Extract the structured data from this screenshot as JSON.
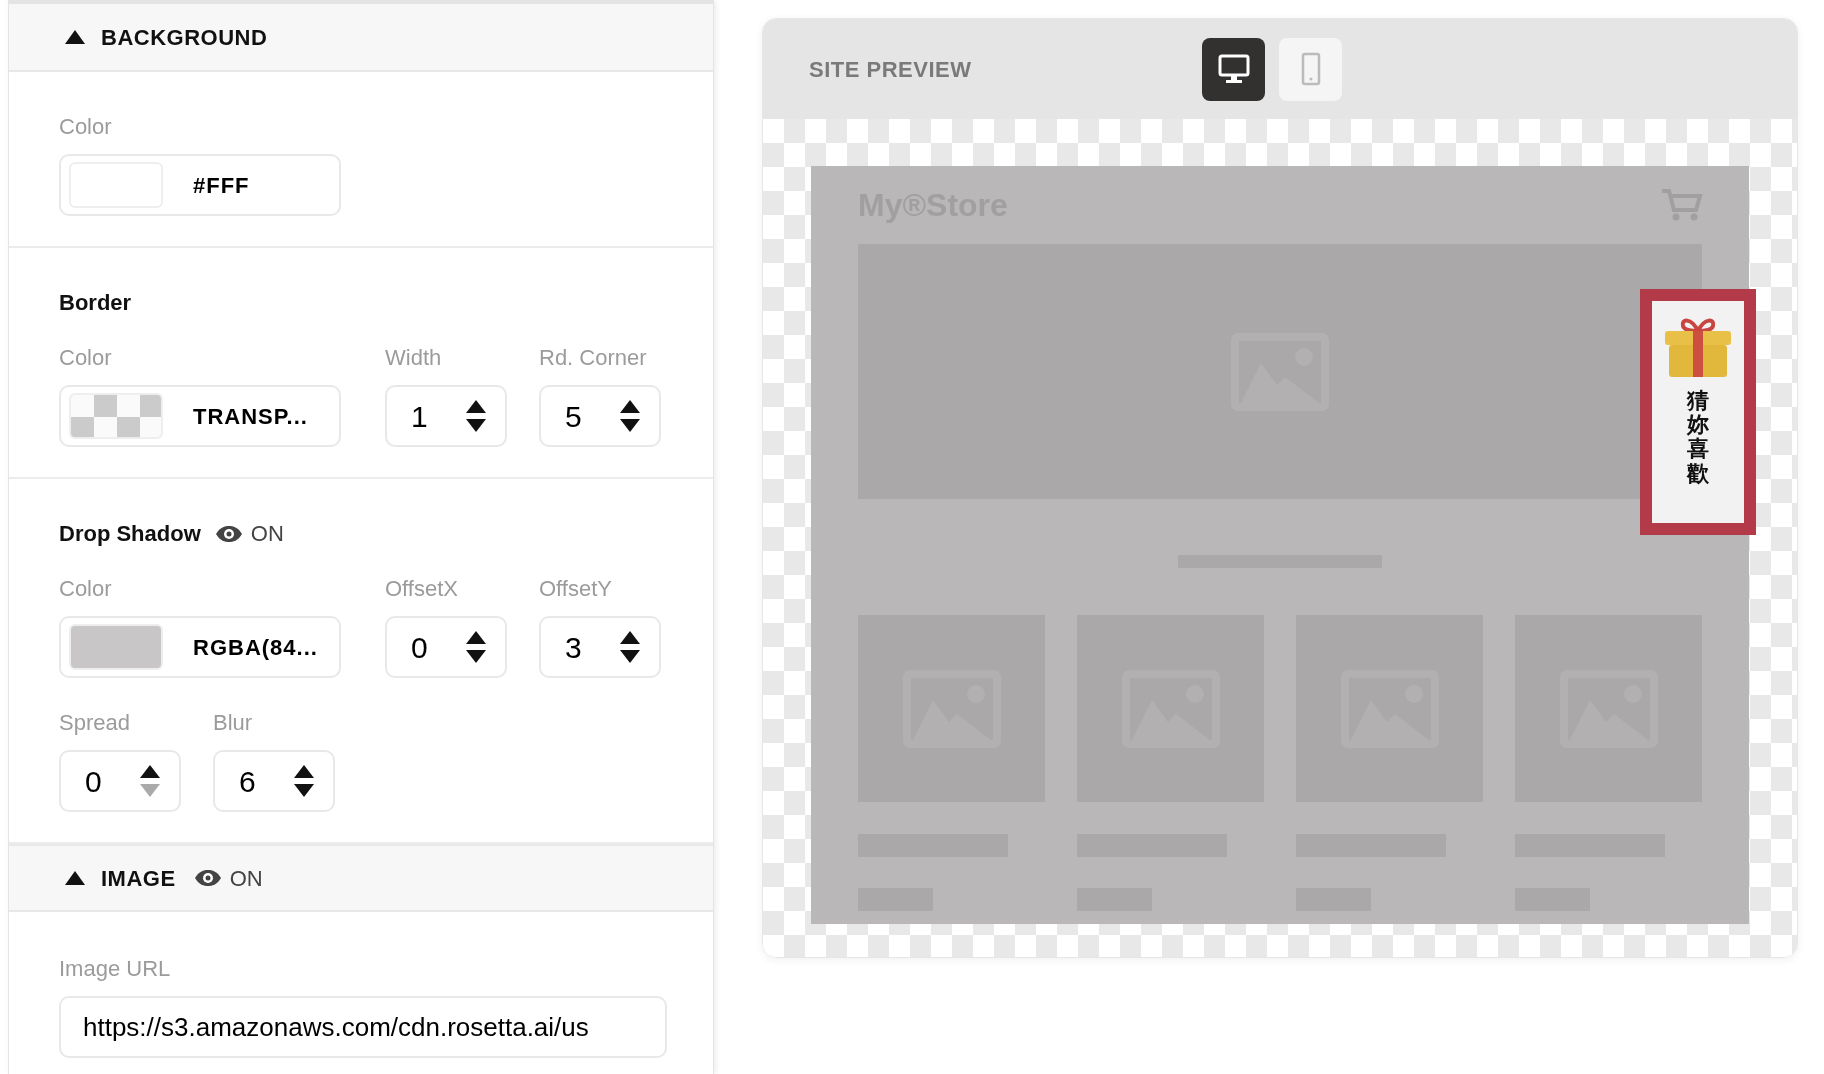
{
  "sections": [
    {
      "kind": "header",
      "title": "BACKGROUND",
      "expanded": true
    },
    {
      "kind": "group",
      "fields": [
        {
          "kind": "color",
          "label": "Color",
          "value": "#FFF",
          "swatch": {
            "kind": "solid",
            "color": "#ffffff"
          }
        }
      ]
    },
    {
      "kind": "group",
      "title": "Border",
      "fields": [
        {
          "kind": "color",
          "label": "Color",
          "value": "TRANSP...",
          "swatch": {
            "kind": "checker"
          }
        },
        {
          "kind": "number",
          "label": "Width",
          "value": "1",
          "down_disabled": false
        },
        {
          "kind": "number",
          "label": "Rd. Corner",
          "value": "5",
          "down_disabled": false
        }
      ]
    },
    {
      "kind": "group",
      "title": "Drop Shadow",
      "status": "ON",
      "fields": [
        {
          "kind": "color",
          "label": "Color",
          "value": "RGBA(84...",
          "swatch": {
            "kind": "solid",
            "color": "#c8c6c7"
          }
        },
        {
          "kind": "number",
          "label": "OffsetX",
          "value": "0",
          "down_disabled": false
        },
        {
          "kind": "number",
          "label": "OffsetY",
          "value": "3",
          "down_disabled": false
        },
        {
          "kind": "number",
          "label": "Spread",
          "value": "0",
          "down_disabled": true
        },
        {
          "kind": "number",
          "label": "Blur",
          "value": "6",
          "down_disabled": false
        }
      ]
    },
    {
      "kind": "header",
      "title": "IMAGE",
      "status": "ON",
      "expanded": true
    },
    {
      "kind": "group",
      "fields": [
        {
          "kind": "text",
          "label": "Image URL",
          "value": "https://s3.amazonaws.com/cdn.rosetta.ai/us"
        }
      ]
    }
  ],
  "preview": {
    "title": "SITE PREVIEW",
    "devices": [
      {
        "kind": "desktop",
        "selected": true
      },
      {
        "kind": "mobile",
        "selected": false
      }
    ],
    "store_name": "My®Store",
    "products": [
      {
        "kind": "placeholder"
      },
      {
        "kind": "placeholder"
      },
      {
        "kind": "placeholder"
      },
      {
        "kind": "placeholder"
      }
    ],
    "widget": {
      "label": "猜妳喜歡"
    }
  }
}
